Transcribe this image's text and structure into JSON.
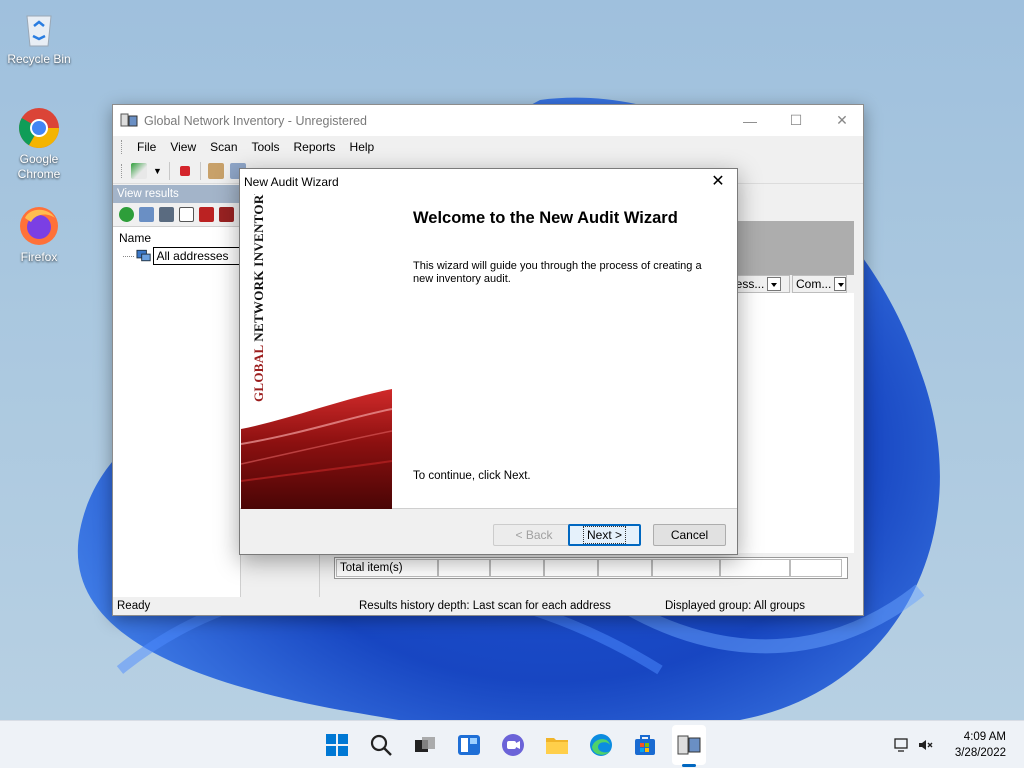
{
  "desktop": {
    "icons": [
      {
        "label": "Recycle Bin"
      },
      {
        "label": "Google Chrome"
      },
      {
        "label": "Firefox"
      }
    ]
  },
  "main_window": {
    "title": "Global Network Inventory - Unregistered",
    "menu": [
      "File",
      "View",
      "Scan",
      "Tools",
      "Reports",
      "Help"
    ],
    "left_pane": {
      "header": "View results",
      "column": "Name",
      "tree_item": "All addresses"
    },
    "columns": [
      "ocess...",
      "Com..."
    ],
    "totals": "Total item(s)",
    "status": {
      "left": "Ready",
      "middle": "Results history depth: Last scan for each address",
      "right": "Displayed group: All groups"
    }
  },
  "wizard": {
    "title": "New Audit Wizard",
    "banner_text_red": "GLOBAL",
    "banner_text": "NETWORK INVENTORY",
    "heading": "Welcome to the New Audit Wizard",
    "description": "This wizard will guide you through the process of creating a new inventory audit.",
    "continue_text": "To continue, click Next.",
    "back_label": "< Back",
    "next_label": "Next >",
    "cancel_label": "Cancel"
  },
  "taskbar": {
    "time": "4:09 AM",
    "date": "3/28/2022"
  },
  "colors": {
    "accent_red": "#9b1c1c",
    "win_blue": "#0067c0",
    "pane_header": "#a3b4c9"
  }
}
